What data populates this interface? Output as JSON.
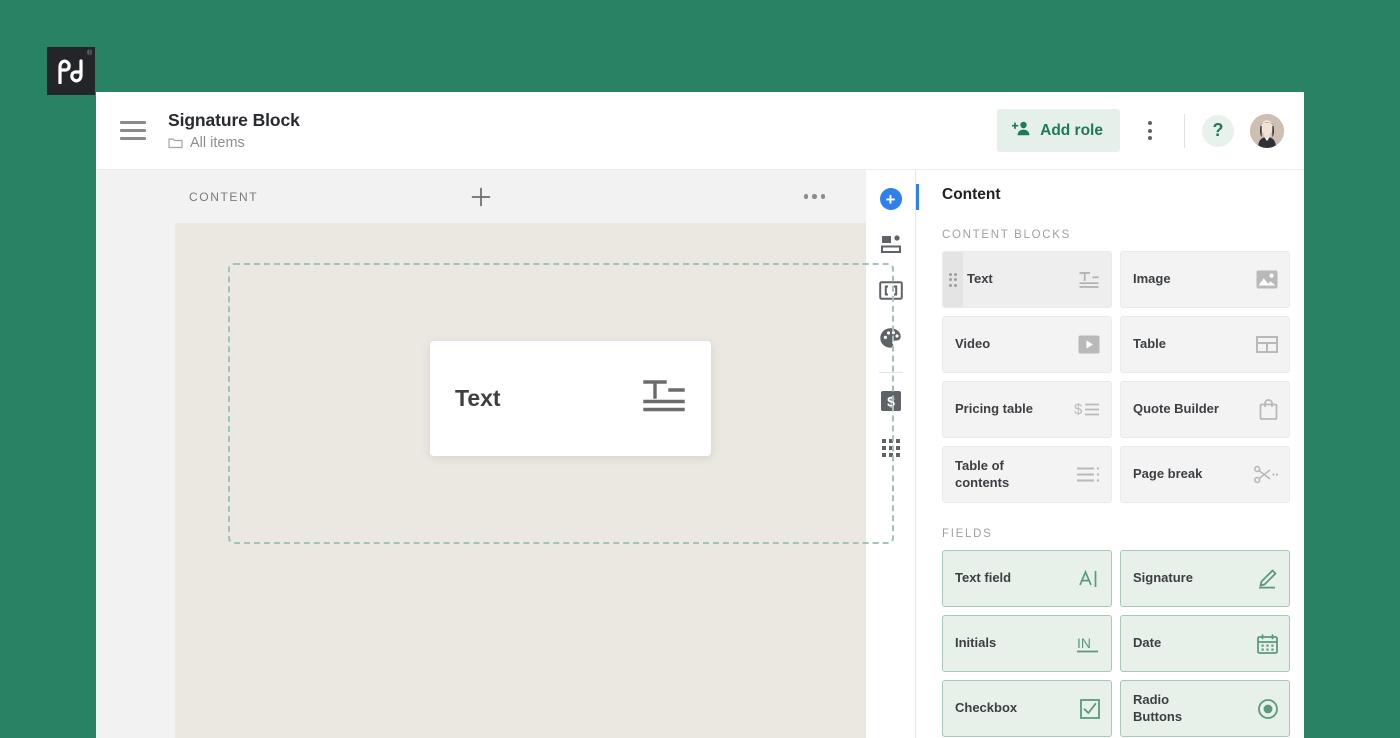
{
  "brand": {
    "logo_text": "pd",
    "trademark": "®",
    "bg_color": "#2a8264",
    "logo_bg": "#232529"
  },
  "topbar": {
    "menu_icon": "hamburger-icon",
    "doc_title": "Signature Block",
    "breadcrumb_icon": "folder-icon",
    "breadcrumb_text": "All items",
    "add_role_label": "Add role",
    "add_role_icon": "add-person-icon",
    "add_role_color": "#1f7a56",
    "kebab_icon": "more-vertical-icon",
    "help_label": "?",
    "avatar_icon": "user-avatar"
  },
  "editor": {
    "section_label": "CONTENT",
    "add_icon": "plus-icon",
    "more_icon": "more-horizontal-icon",
    "canvas_color": "#ebe7e1",
    "dropzone_border_color": "#a3c4b4",
    "drag_card": {
      "label": "Text",
      "icon": "text-block-icon"
    }
  },
  "rail": {
    "items": [
      {
        "name": "add-content",
        "icon": "plus-circle-icon",
        "active": true
      },
      {
        "name": "layout-blocks",
        "icon": "layout-icon",
        "active": false
      },
      {
        "name": "variables",
        "icon": "brackets-icon",
        "active": false
      },
      {
        "name": "theme",
        "icon": "palette-icon",
        "active": false
      },
      {
        "name": "pricing",
        "icon": "dollar-icon",
        "active": false
      },
      {
        "name": "apps",
        "icon": "grid-apps-icon",
        "active": false
      }
    ],
    "active_color": "#2f80ed"
  },
  "panel": {
    "title": "Content",
    "accent_color": "#2f80ed",
    "sections": [
      {
        "label": "CONTENT BLOCKS",
        "tiles": [
          {
            "label": "Text",
            "icon": "text-block-icon",
            "dragging": true,
            "handle_icon": "drag-handle-icon"
          },
          {
            "label": "Image",
            "icon": "image-icon",
            "dragging": false
          },
          {
            "label": "Video",
            "icon": "video-play-icon",
            "dragging": false
          },
          {
            "label": "Table",
            "icon": "table-grid-icon",
            "dragging": false
          },
          {
            "label": "Pricing table",
            "icon": "pricing-dollar-list-icon",
            "dragging": false
          },
          {
            "label": "Quote Builder",
            "icon": "shopping-bag-icon",
            "dragging": false
          },
          {
            "label": "Table of contents",
            "icon": "toc-lines-icon",
            "dragging": false
          },
          {
            "label": "Page break",
            "icon": "scissors-icon",
            "dragging": false
          }
        ]
      },
      {
        "label": "FIELDS",
        "field_style": true,
        "tiles": [
          {
            "label": "Text field",
            "icon": "text-cursor-icon"
          },
          {
            "label": "Signature",
            "icon": "signature-pen-icon"
          },
          {
            "label": "Initials",
            "icon": "initials-in-icon"
          },
          {
            "label": "Date",
            "icon": "calendar-icon"
          },
          {
            "label": "Checkbox",
            "icon": "checkbox-icon"
          },
          {
            "label": "Radio Buttons",
            "icon": "radio-button-icon"
          }
        ]
      }
    ]
  }
}
